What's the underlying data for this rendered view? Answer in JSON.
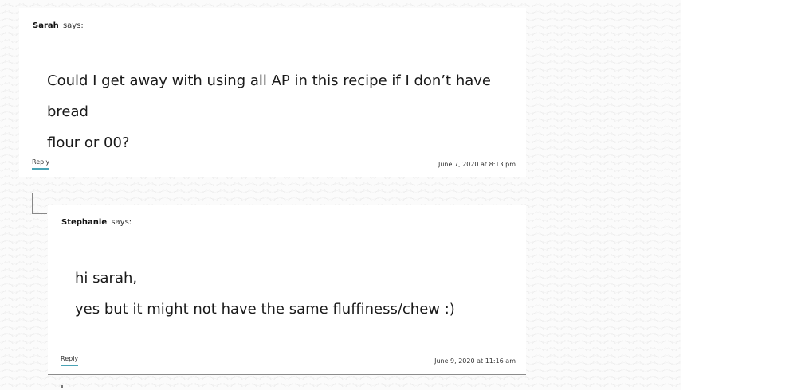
{
  "comments": [
    {
      "author": "Sarah",
      "says": "says:",
      "body": [
        "Could I get away with using all AP in this recipe if I don’t have bread",
        "flour or 00?"
      ],
      "reply_label": "Reply",
      "timestamp": "June 7, 2020 at 8:13 pm"
    },
    {
      "author": "Stephanie",
      "says": "says:",
      "body": [
        "hi sarah,",
        "yes but it might not have the same fluffiness/chew :)"
      ],
      "reply_label": "Reply",
      "timestamp": "June 9, 2020 at 11:16 am"
    }
  ],
  "colors": {
    "reply_underline": "#4aa3b5",
    "divider": "#8c8c8c"
  }
}
